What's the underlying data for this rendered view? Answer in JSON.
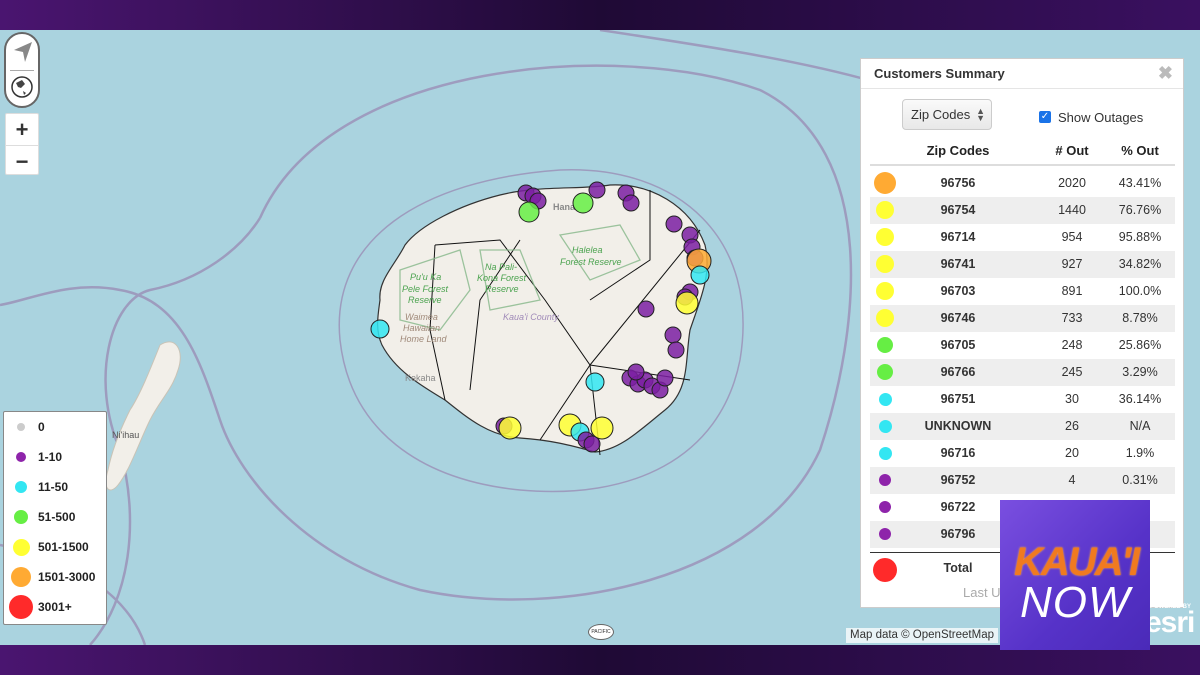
{
  "map": {
    "labels": {
      "hanalei": "Hana",
      "halelea": "Halelea",
      "halelea2": "Forest Reserve",
      "napali": "Na Pali-",
      "napali2": "Kona Forest",
      "napali3": "Reserve",
      "puuka": "Pu'u Ka",
      "puuka2": "Pele Forest",
      "puuka3": "Reserve",
      "waimea": "Waimea",
      "waimea2": "Hawaiian",
      "waimea3": "Home Land",
      "county": "Kaua'i County",
      "kekaha": "Kekaha",
      "niihau": "Ni'ihau"
    },
    "attribution": "Map data © OpenStreetMap",
    "esri": "esri",
    "esri_powered": "POWERED BY",
    "pacific_logo": "PACIFIC",
    "colors": {
      "ocean": "#aad3df",
      "land": "#f2efe9",
      "ring": "#9b8fb6"
    }
  },
  "controls": {
    "zoom_in": "+",
    "zoom_out": "−",
    "locate_icon": "navigation-arrow-icon",
    "home_icon": "globe-icon"
  },
  "legend": {
    "items": [
      {
        "label": "0",
        "color": "#cccccc"
      },
      {
        "label": "1-10",
        "color": "#8e24aa"
      },
      {
        "label": "11-50",
        "color": "#33e6f2"
      },
      {
        "label": "51-500",
        "color": "#66ee44"
      },
      {
        "label": "501-1500",
        "color": "#ffff33"
      },
      {
        "label": "1501-3000",
        "color": "#ffaa33"
      },
      {
        "label": "3001+",
        "color": "#ff2a2a"
      }
    ]
  },
  "panel": {
    "title": "Customers Summary",
    "close": "✖",
    "select_value": "Zip Codes",
    "show_outages_label": "Show Outages",
    "show_outages_checked": true,
    "headers": {
      "zip": "Zip Codes",
      "out": "# Out",
      "pct": "% Out"
    },
    "rows": [
      {
        "zip": "96756",
        "out": "2020",
        "pct": "43.41%",
        "color": "#ffaa33"
      },
      {
        "zip": "96754",
        "out": "1440",
        "pct": "76.76%",
        "color": "#ffff33"
      },
      {
        "zip": "96714",
        "out": "954",
        "pct": "95.88%",
        "color": "#ffff33"
      },
      {
        "zip": "96741",
        "out": "927",
        "pct": "34.82%",
        "color": "#ffff33"
      },
      {
        "zip": "96703",
        "out": "891",
        "pct": "100.0%",
        "color": "#ffff33"
      },
      {
        "zip": "96746",
        "out": "733",
        "pct": "8.78%",
        "color": "#ffff33"
      },
      {
        "zip": "96705",
        "out": "248",
        "pct": "25.86%",
        "color": "#66ee44"
      },
      {
        "zip": "96766",
        "out": "245",
        "pct": "3.29%",
        "color": "#66ee44"
      },
      {
        "zip": "96751",
        "out": "30",
        "pct": "36.14%",
        "color": "#33e6f2"
      },
      {
        "zip": "UNKNOWN",
        "out": "26",
        "pct": "N/A",
        "color": "#33e6f2"
      },
      {
        "zip": "96716",
        "out": "20",
        "pct": "1.9%",
        "color": "#33e6f2"
      },
      {
        "zip": "96752",
        "out": "4",
        "pct": "0.31%",
        "color": "#8e24aa"
      },
      {
        "zip": "96722",
        "out": "",
        "pct": "",
        "color": "#8e24aa"
      },
      {
        "zip": "96796",
        "out": "",
        "pct": "",
        "color": "#8e24aa"
      }
    ],
    "total_label": "Total",
    "total_color": "#ff2a2a",
    "last_updated": "Last U                              2021"
  },
  "logo": {
    "line1": "KAUA'I",
    "line2": "NOW"
  }
}
